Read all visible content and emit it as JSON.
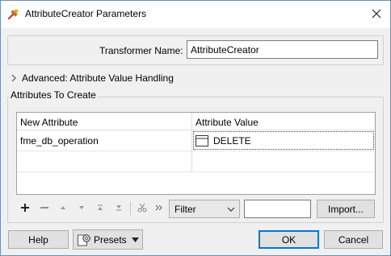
{
  "window": {
    "title": "AttributeCreator Parameters",
    "icon": "fme-transformer-icon"
  },
  "transformer": {
    "name_label": "Transformer Name:",
    "name_value": "AttributeCreator"
  },
  "advanced": {
    "label": "Advanced: Attribute Value Handling",
    "expanded": false
  },
  "attributes": {
    "group_label": "Attributes To Create",
    "columns": [
      "New Attribute",
      "Attribute Value"
    ],
    "rows": [
      {
        "name": "fme_db_operation",
        "value": "DELETE",
        "value_icon": "text-value-icon"
      }
    ]
  },
  "toolbar": {
    "icons": [
      "add-icon",
      "remove-icon",
      "move-up-icon",
      "move-down-icon",
      "move-top-icon",
      "move-bottom-icon",
      "cut-icon",
      "more-icon"
    ],
    "filter_selected": "Filter",
    "filter_text": "",
    "import_label": "Import..."
  },
  "footer": {
    "help_label": "Help",
    "presets_label": "Presets",
    "ok_label": "OK",
    "cancel_label": "Cancel"
  },
  "colors": {
    "window_bg": "#f0f0f0",
    "accent": "#0078d7",
    "titlebar_bg": "#ffffff"
  }
}
